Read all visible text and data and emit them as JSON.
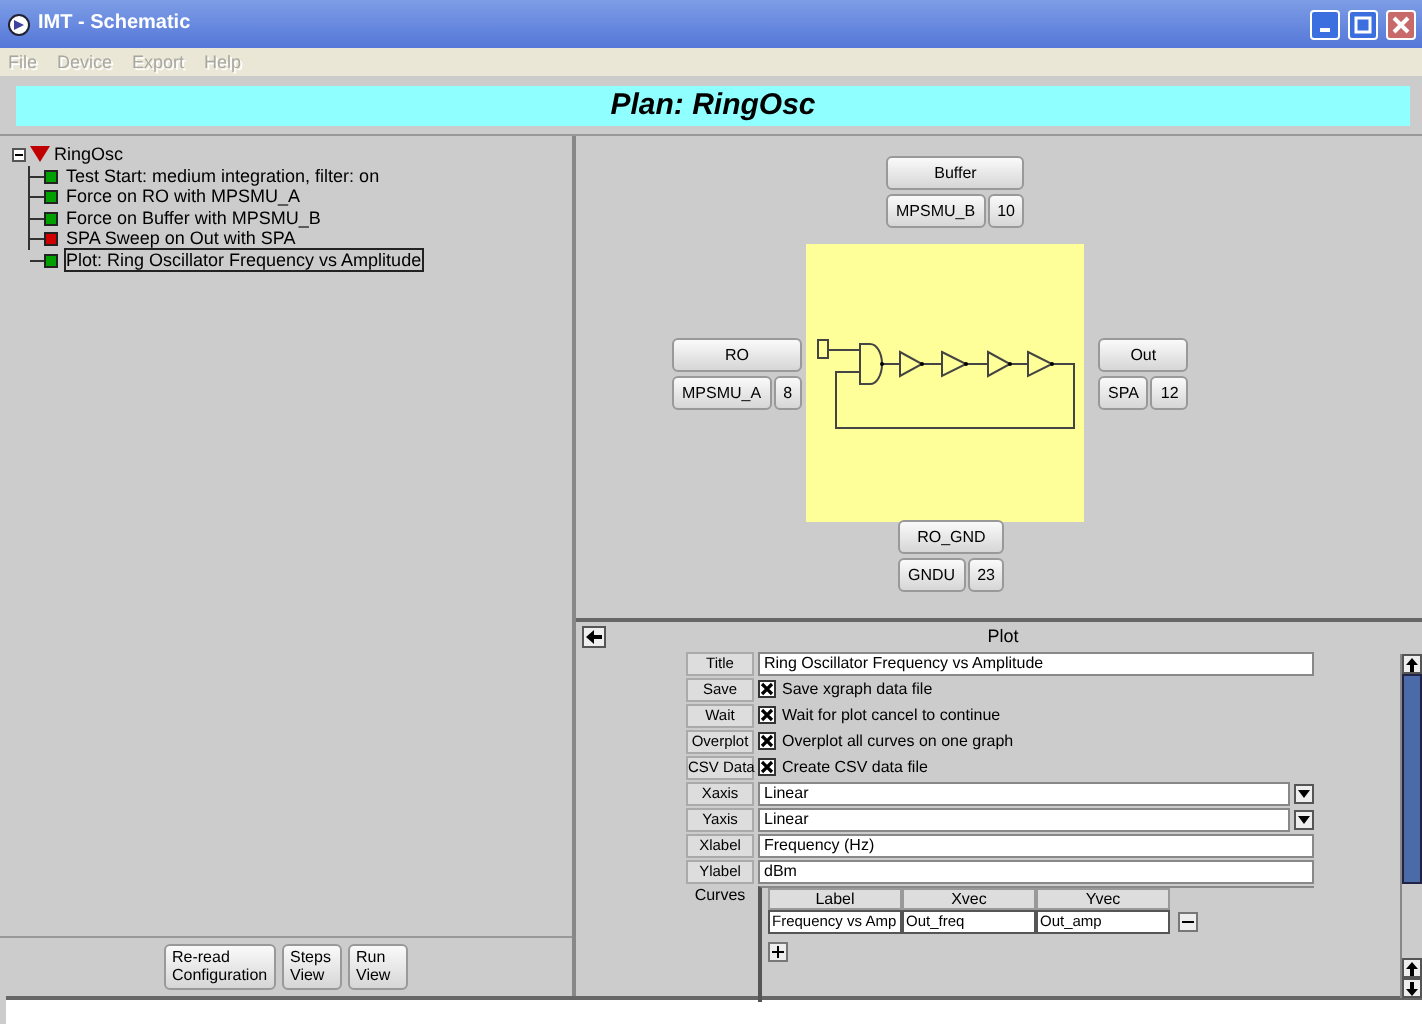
{
  "window": {
    "title": "IMT - Schematic"
  },
  "menu": [
    {
      "label": "File",
      "disabled": true
    },
    {
      "label": "Device",
      "disabled": true
    },
    {
      "label": "Export",
      "disabled": true
    },
    {
      "label": "Help",
      "disabled": true
    }
  ],
  "plan_title": "Plan: RingOsc",
  "tree": {
    "label": "RingOsc",
    "expanded": true,
    "children": [
      {
        "label": "Test Start: medium integration, filter: on",
        "color": "#00a000",
        "selected": false
      },
      {
        "label": "Force on RO with MPSMU_A",
        "color": "#00a000",
        "selected": false
      },
      {
        "label": "Force on Buffer with MPSMU_B",
        "color": "#00a000",
        "selected": false
      },
      {
        "label": "SPA Sweep on Out with SPA",
        "color": "#d00000",
        "selected": false
      },
      {
        "label": "Plot: Ring Oscillator Frequency vs Amplitude",
        "color": "#00a000",
        "selected": true
      }
    ]
  },
  "buttons": [
    "Re-read Configuration",
    "Steps View",
    "Run View"
  ],
  "schematic": {
    "pins": {
      "top": {
        "name": "Buffer",
        "instrument": "MPSMU_B",
        "channel": "10"
      },
      "left": {
        "name": "RO",
        "instrument": "MPSMU_A",
        "channel": "8"
      },
      "right": {
        "name": "Out",
        "instrument": "SPA",
        "channel": "12"
      },
      "bottom": {
        "name": "RO_GND",
        "instrument": "GNDU",
        "channel": "23"
      }
    }
  },
  "plot": {
    "title": "Plot",
    "fields": [
      {
        "kind": "text",
        "label": "Title",
        "value": "Ring Oscillator Frequency vs Amplitude"
      },
      {
        "kind": "checkbox",
        "label": "Save",
        "text": "Save xgraph data file",
        "checked": true
      },
      {
        "kind": "checkbox",
        "label": "Wait",
        "text": "Wait for plot cancel to continue",
        "checked": true
      },
      {
        "kind": "checkbox",
        "label": "Overplot",
        "text": "Overplot all curves on one graph",
        "checked": true
      },
      {
        "kind": "checkbox",
        "label": "CSV Data",
        "text": "Create CSV data file",
        "checked": true
      },
      {
        "kind": "select",
        "label": "Xaxis",
        "value": "Linear"
      },
      {
        "kind": "select",
        "label": "Yaxis",
        "value": "Linear"
      },
      {
        "kind": "text",
        "label": "Xlabel",
        "value": "Frequency (Hz)"
      },
      {
        "kind": "text",
        "label": "Ylabel",
        "value": "dBm"
      }
    ],
    "curves": {
      "label": "Curves",
      "columns": [
        "Label",
        "Xvec",
        "Yvec"
      ],
      "rows": [
        [
          "Frequency  vs Amp",
          "Out_freq",
          "Out_amp"
        ]
      ]
    }
  }
}
